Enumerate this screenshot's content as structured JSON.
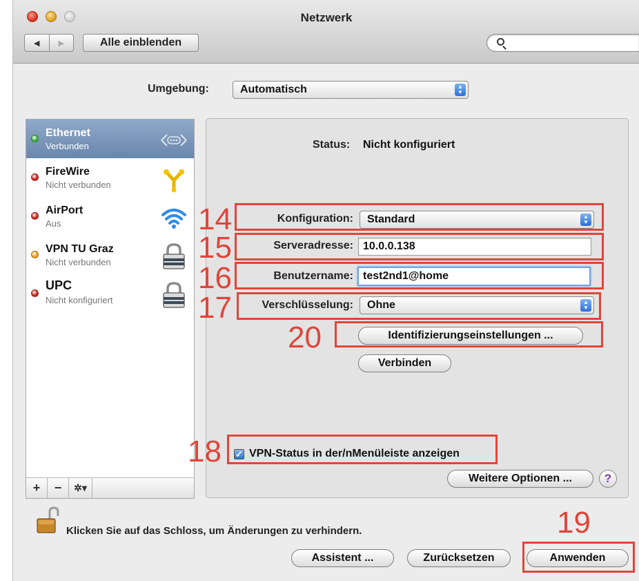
{
  "window": {
    "title": "Netzwerk"
  },
  "toolbar": {
    "back_glyph": "◀",
    "forward_glyph": "▶",
    "show_all_label": "Alle einblenden",
    "search_placeholder": ""
  },
  "location": {
    "label": "Umgebung:",
    "value": "Automatisch"
  },
  "services": [
    {
      "name": "Ethernet",
      "status": "Verbunden",
      "dot_color": "#3fb13f",
      "icon": "ethernet-icon",
      "selected": true
    },
    {
      "name": "FireWire",
      "status": "Nicht verbunden",
      "dot_color": "#d0221b",
      "icon": "firewire-icon",
      "selected": false
    },
    {
      "name": "AirPort",
      "status": "Aus",
      "dot_color": "#d0221b",
      "icon": "wifi-icon",
      "selected": false
    },
    {
      "name": "VPN TU Graz",
      "status": "Nicht verbunden",
      "dot_color": "#e8a21a",
      "icon": "lock-icon",
      "selected": false
    },
    {
      "name": "UPC",
      "status": "Nicht konfiguriert",
      "dot_color": "#d0221b",
      "icon": "lock-icon",
      "selected": false
    }
  ],
  "sidebar_tools": {
    "add": "+",
    "remove": "−",
    "action": "✲▾"
  },
  "detail": {
    "status_label": "Status:",
    "status_value": "Nicht konfiguriert",
    "config_label": "Konfiguration:",
    "config_value": "Standard",
    "server_label": "Serveradresse:",
    "server_value": "10.0.0.138",
    "user_label": "Benutzername:",
    "user_value": "test2nd1@home",
    "encryption_label": "Verschlüsselung:",
    "encryption_value": "Ohne",
    "auth_settings_button": "Identifizierungseinstellungen ...",
    "connect_button": "Verbinden",
    "vpn_status_checkbox_label": "VPN-Status in der/nMenüleiste anzeigen",
    "vpn_status_checked": true,
    "more_options_button": "Weitere Optionen ...",
    "help_glyph": "?"
  },
  "footer": {
    "lock_text": "Klicken Sie auf das Schloss, um Änderungen zu verhindern.",
    "assistant_button": "Assistent ...",
    "revert_button": "Zurücksetzen",
    "apply_button": "Anwenden"
  },
  "annotations": [
    "14",
    "15",
    "16",
    "17",
    "20",
    "18",
    "19"
  ],
  "colors": {
    "annotation": "#e0453a",
    "selection": "#7b96ba",
    "accent_blue": "#3570d4"
  }
}
